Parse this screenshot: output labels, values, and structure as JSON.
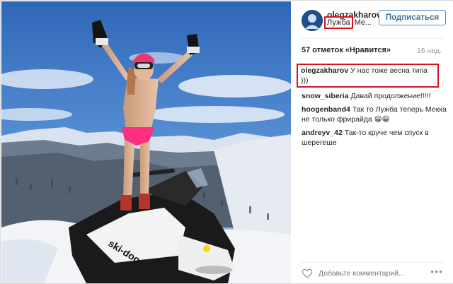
{
  "post": {
    "username": "olegzakharov",
    "location_highlight": "Лужба",
    "location_rest": "Ме...",
    "follow_label": "Подписаться",
    "likes_text": "57 отметок «Нравится»",
    "age": "16 нед.",
    "comments": [
      {
        "user": "olegzakharov",
        "text": "У нас тоже весна типа )))",
        "highlighted": true
      },
      {
        "user": "snow_siberia",
        "text": "Давай продолжение!!!!!",
        "highlighted": false
      },
      {
        "user": "hoogenband4",
        "text": "Так то Лужба теперь Мекка не только фрирайда 😀😀",
        "highlighted": false
      },
      {
        "user": "andreyv_42",
        "text": "Так-то круче чем спуск в шерегеше",
        "highlighted": false
      }
    ],
    "add_comment_placeholder": "Добавьте комментарий...",
    "more_label": "•••"
  },
  "photo": {
    "sled_brand": "ski-doo",
    "icons": {
      "like": "heart-icon",
      "more": "more-options-icon",
      "avatar": "avatar"
    }
  },
  "colors": {
    "highlight_box": "#d8141a",
    "follow_button": "#3f729b",
    "sky": "#3f78c8",
    "snow": "#f2f4f8"
  }
}
